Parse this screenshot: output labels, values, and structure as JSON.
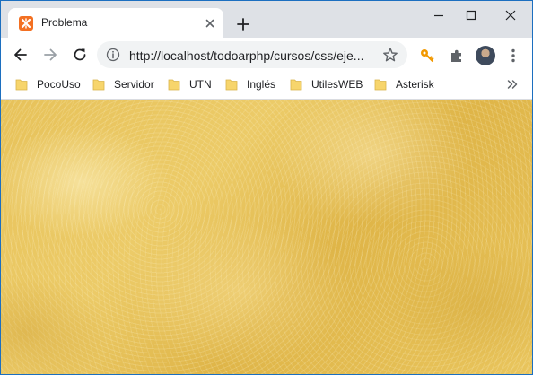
{
  "tab": {
    "title": "Problema",
    "favicon": "xampp-icon"
  },
  "toolbar": {
    "url": "http://localhost/todoarphp/cursos/css/eje...",
    "back_icon": "back-arrow-icon",
    "forward_icon": "forward-arrow-icon",
    "reload_icon": "reload-icon"
  },
  "bookmarks": [
    {
      "label": "PocoUso"
    },
    {
      "label": "Servidor"
    },
    {
      "label": "UTN"
    },
    {
      "label": "Inglés"
    },
    {
      "label": "UtilesWEB"
    },
    {
      "label": "Asterisk"
    }
  ],
  "colors": {
    "tabstrip": "#dee1e6",
    "favicon": "#f37022",
    "key_extension": "#f29900",
    "page_background": "#e7c25a"
  }
}
